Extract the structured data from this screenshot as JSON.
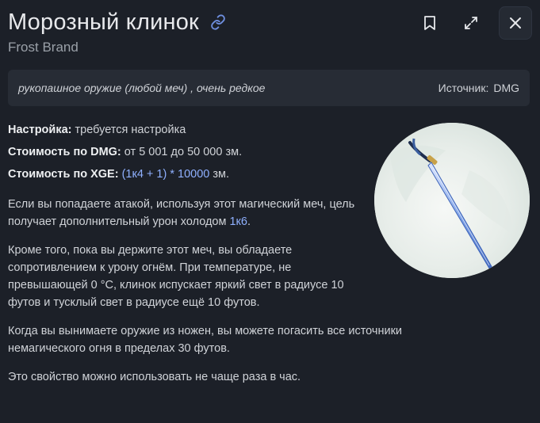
{
  "item": {
    "title": "Морозный клинок",
    "subtitle": "Frost Brand"
  },
  "meta": {
    "type_text": "рукопашное оружие (любой меч) , очень редкое",
    "source_label": "Источник:",
    "source_value": "DMG"
  },
  "properties": [
    {
      "label": "Настройка:",
      "value": "требуется настройка"
    },
    {
      "label": "Стоимость по DMG:",
      "value": "от 5 001 до 50 000 зм."
    },
    {
      "label": "Стоимость по XGE:",
      "formula": "(1к4 + 1) * 10000",
      "unit": "зм."
    }
  ],
  "description": {
    "p1_text": "Если вы попадаете атакой, используя этот магический меч, цель получает дополнительный урон холодом",
    "p1_dice": "1к6",
    "p1_end": ".",
    "p2": "Кроме того, пока вы держите этот меч, вы обладаете сопротивлением к урону огнём. При температуре, не превышающей 0 °C, клинок испускает яркий свет в радиусе 10 футов и тусклый свет в радиусе ещё 10 футов.",
    "p3": "Когда вы вынимаете оружие из ножен, вы можете погасить все источники немагического огня в пределах 30 футов.",
    "p4": "Это свойство можно использовать не чаще раза в час."
  },
  "icons": {
    "link": "link-icon",
    "bookmark": "bookmark-icon",
    "expand": "expand-icon",
    "close": "close-icon"
  },
  "colors": {
    "background": "#1c2028",
    "panel": "#272c35",
    "accent": "#8fb0ff"
  }
}
